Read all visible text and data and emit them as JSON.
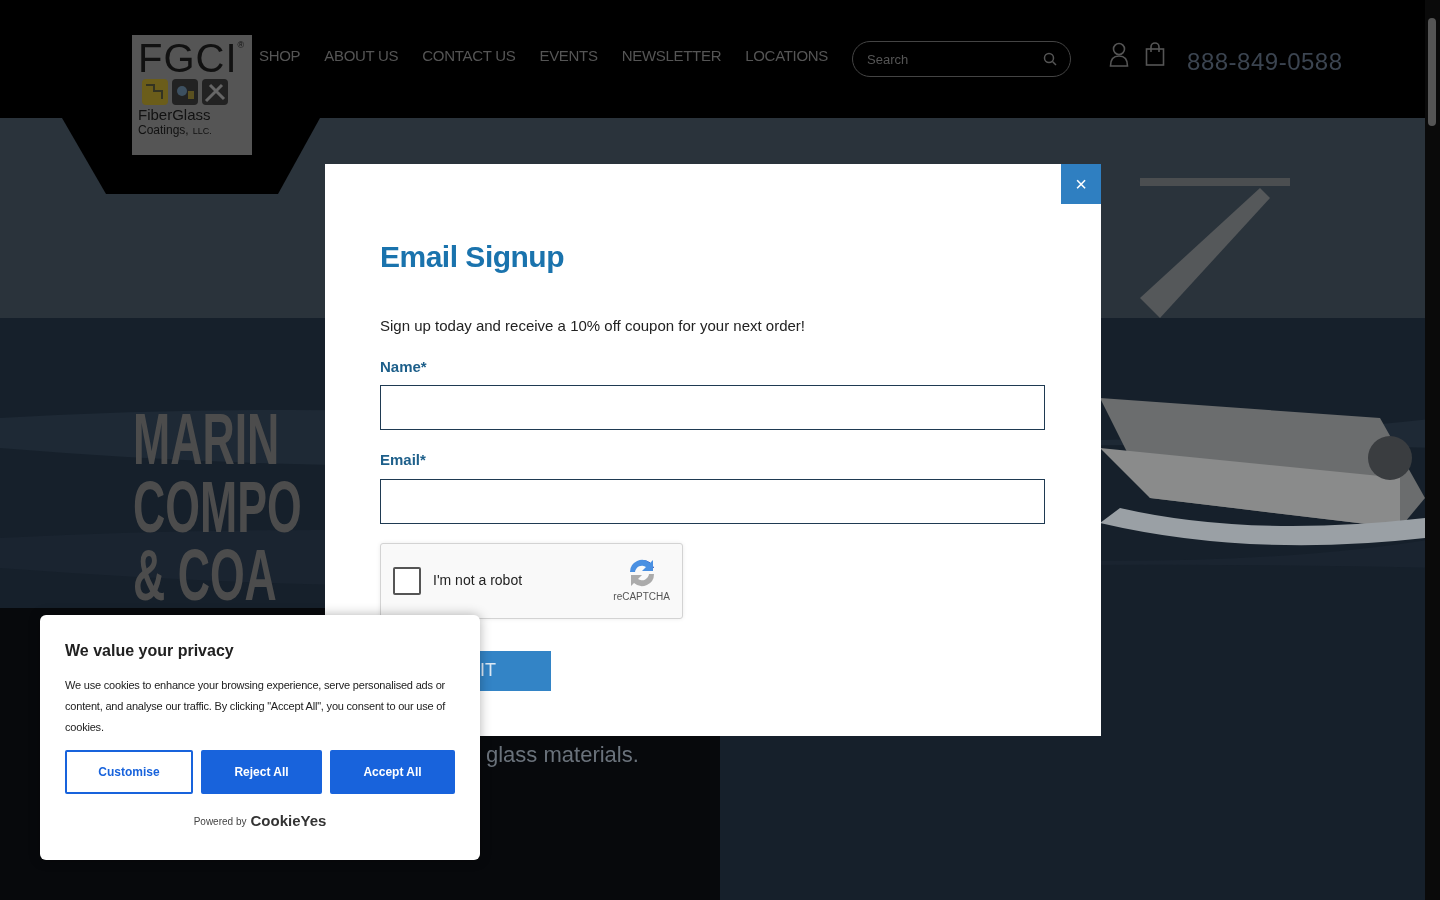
{
  "header": {
    "logo": {
      "letters": "FGCI",
      "registered": "®",
      "line1": "FiberGlass",
      "line2": "Coatings,",
      "suffix": "LLC."
    },
    "nav": [
      "SHOP",
      "ABOUT US",
      "CONTACT US",
      "EVENTS",
      "NEWSLETTER",
      "LOCATIONS"
    ],
    "search": {
      "placeholder": "Search"
    },
    "phone": "888-849-0588"
  },
  "hero": {
    "headline": [
      "MARIN",
      "COMPO",
      "& COA"
    ],
    "tagline": "glass materials."
  },
  "modal": {
    "close": "×",
    "title": "Email Signup",
    "intro": "Sign up today and receive a 10% off coupon for your next order!",
    "fields": [
      {
        "label": "Name*"
      },
      {
        "label": "Email*"
      }
    ],
    "captcha": {
      "label": "I'm not a robot",
      "checked": false,
      "brand": "reCAPTCHA"
    },
    "submit": "IT"
  },
  "cookie_banner": {
    "title": "We value your privacy",
    "text": "We use cookies to enhance your browsing experience, serve personalised ads or content, and analyse our traffic. By clicking \"Accept All\", you consent to our use of cookies.",
    "buttons": [
      {
        "label": "Customise",
        "kind": "outline"
      },
      {
        "label": "Reject All",
        "kind": "solid"
      },
      {
        "label": "Accept All",
        "kind": "solid"
      }
    ],
    "powered_by": "Powered by",
    "brand": "CookieYes"
  }
}
